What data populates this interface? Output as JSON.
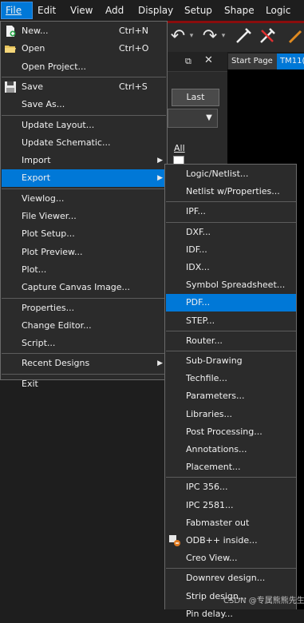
{
  "menubar": [
    {
      "name": "menu-file",
      "label": "File",
      "active": true
    },
    {
      "name": "menu-edit",
      "label": "Edit"
    },
    {
      "name": "menu-view",
      "label": "View"
    },
    {
      "name": "menu-add",
      "label": "Add"
    },
    {
      "name": "menu-display",
      "label": "Display"
    },
    {
      "name": "menu-setup",
      "label": "Setup"
    },
    {
      "name": "menu-shape",
      "label": "Shape"
    },
    {
      "name": "menu-logic",
      "label": "Logic"
    }
  ],
  "panel": {
    "last_button": "Last",
    "all_label": "All",
    "max_icon": "restore-icon",
    "close_icon": "close-icon"
  },
  "doc_tabs": [
    "Start Page",
    "TM11("
  ],
  "file_menu": [
    {
      "name": "file-new",
      "label": "New...",
      "shortcut": "Ctrl+N",
      "icon": "new-file-icon"
    },
    {
      "name": "file-open",
      "label": "Open",
      "shortcut": "Ctrl+O",
      "icon": "open-folder-icon"
    },
    {
      "name": "file-open-project",
      "label": "Open Project..."
    },
    {
      "sep": true
    },
    {
      "name": "file-save",
      "label": "Save",
      "shortcut": "Ctrl+S",
      "icon": "save-icon"
    },
    {
      "name": "file-save-as",
      "label": "Save As..."
    },
    {
      "sep": true
    },
    {
      "name": "file-update-layout",
      "label": "Update Layout..."
    },
    {
      "name": "file-update-schematic",
      "label": "Update Schematic..."
    },
    {
      "name": "file-import",
      "label": "Import",
      "submenu": true
    },
    {
      "name": "file-export",
      "label": "Export",
      "submenu": true,
      "highlighted": true
    },
    {
      "sep": true
    },
    {
      "name": "file-viewlog",
      "label": "Viewlog..."
    },
    {
      "name": "file-file-viewer",
      "label": "File Viewer..."
    },
    {
      "name": "file-plot-setup",
      "label": "Plot Setup..."
    },
    {
      "name": "file-plot-preview",
      "label": "Plot Preview..."
    },
    {
      "name": "file-plot",
      "label": "Plot..."
    },
    {
      "name": "file-capture-canvas",
      "label": "Capture Canvas Image..."
    },
    {
      "sep": true
    },
    {
      "name": "file-properties",
      "label": "Properties..."
    },
    {
      "name": "file-change-editor",
      "label": "Change Editor..."
    },
    {
      "name": "file-script",
      "label": "Script..."
    },
    {
      "sep": true
    },
    {
      "name": "file-recent-designs",
      "label": "Recent Designs",
      "submenu": true
    },
    {
      "sep": true
    },
    {
      "name": "file-exit",
      "label": "Exit"
    }
  ],
  "export_menu": [
    {
      "name": "export-logic-netlist",
      "label": "Logic/Netlist..."
    },
    {
      "name": "export-netlist-properties",
      "label": "Netlist w/Properties..."
    },
    {
      "sep": true
    },
    {
      "name": "export-ipf",
      "label": "IPF..."
    },
    {
      "sep": true
    },
    {
      "name": "export-dxf",
      "label": "DXF..."
    },
    {
      "name": "export-idf",
      "label": "IDF..."
    },
    {
      "name": "export-idx",
      "label": "IDX..."
    },
    {
      "name": "export-symbol-spreadsheet",
      "label": "Symbol Spreadsheet..."
    },
    {
      "name": "export-pdf",
      "label": "PDF...",
      "highlighted": true
    },
    {
      "name": "export-step",
      "label": "STEP..."
    },
    {
      "sep": true
    },
    {
      "name": "export-router",
      "label": "Router..."
    },
    {
      "sep": true
    },
    {
      "name": "export-sub-drawing",
      "label": "Sub-Drawing"
    },
    {
      "name": "export-techfile",
      "label": "Techfile..."
    },
    {
      "name": "export-parameters",
      "label": "Parameters..."
    },
    {
      "name": "export-libraries",
      "label": "Libraries..."
    },
    {
      "name": "export-post-processing",
      "label": "Post Processing..."
    },
    {
      "name": "export-annotations",
      "label": "Annotations..."
    },
    {
      "name": "export-placement",
      "label": "Placement..."
    },
    {
      "sep": true
    },
    {
      "name": "export-ipc-356",
      "label": "IPC 356..."
    },
    {
      "name": "export-ipc-2581",
      "label": "IPC 2581..."
    },
    {
      "name": "export-fabmaster-out",
      "label": "Fabmaster out"
    },
    {
      "name": "export-odb-inside",
      "label": "ODB++ inside...",
      "icon": "odb-icon"
    },
    {
      "name": "export-creo-view",
      "label": "Creo View..."
    },
    {
      "sep": true
    },
    {
      "name": "export-downrev-design",
      "label": "Downrev design..."
    },
    {
      "name": "export-strip-design",
      "label": "Strip design..."
    },
    {
      "name": "export-pin-delay",
      "label": "Pin delay..."
    }
  ],
  "watermark": "CSDN @专属熊熊先生",
  "colors": {
    "highlight": "#0078d7",
    "menu_bg": "#2b2b2b",
    "accent_red": "#8b0d0d"
  }
}
